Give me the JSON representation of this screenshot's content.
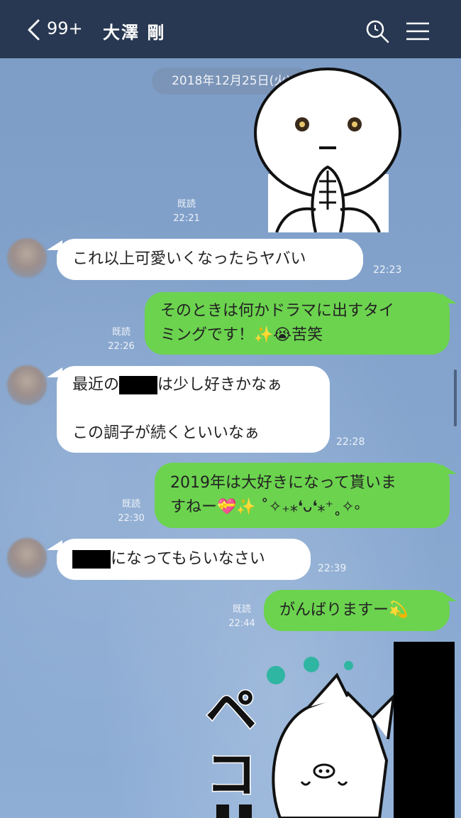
{
  "header": {
    "back_count": "99+",
    "contact_name": "大澤 剛"
  },
  "date_separator": "2018年12月25日(火)",
  "messages": [
    {
      "side": "right",
      "type": "sticker",
      "read": "既読",
      "time": "22:21"
    },
    {
      "side": "left",
      "text": "これ以上可愛いくなったらヤバい",
      "time": "22:23"
    },
    {
      "side": "right",
      "lines": [
        "そのときは何かドラマに出すタイ",
        "ミングです！✨😭苦笑"
      ],
      "read": "既読",
      "time": "22:26"
    },
    {
      "side": "left",
      "line1_before": "最近の",
      "line1_after": "は少し好きかなぁ",
      "line2": "この調子が続くといいなぁ",
      "time": "22:28"
    },
    {
      "side": "right",
      "lines": [
        "2019年は大好きになって貰いま",
        "すねー💝✨ ˚✧₊⁎❛ᴗ❛⁎⁺˳✧༚"
      ],
      "read": "既読",
      "time": "22:30"
    },
    {
      "side": "left",
      "text_after": "になってもらいなさい",
      "time": "22:39"
    },
    {
      "side": "right",
      "text": "がんばりますー💫",
      "read": "既読",
      "time": "22:44"
    },
    {
      "side": "right",
      "type": "sticker",
      "sticker_text": "ペコリ"
    }
  ],
  "colors": {
    "header_bg": "#283852",
    "chat_bg": "#7f9fc9",
    "bubble_right": "#6cd34f",
    "bubble_left": "#ffffff"
  }
}
